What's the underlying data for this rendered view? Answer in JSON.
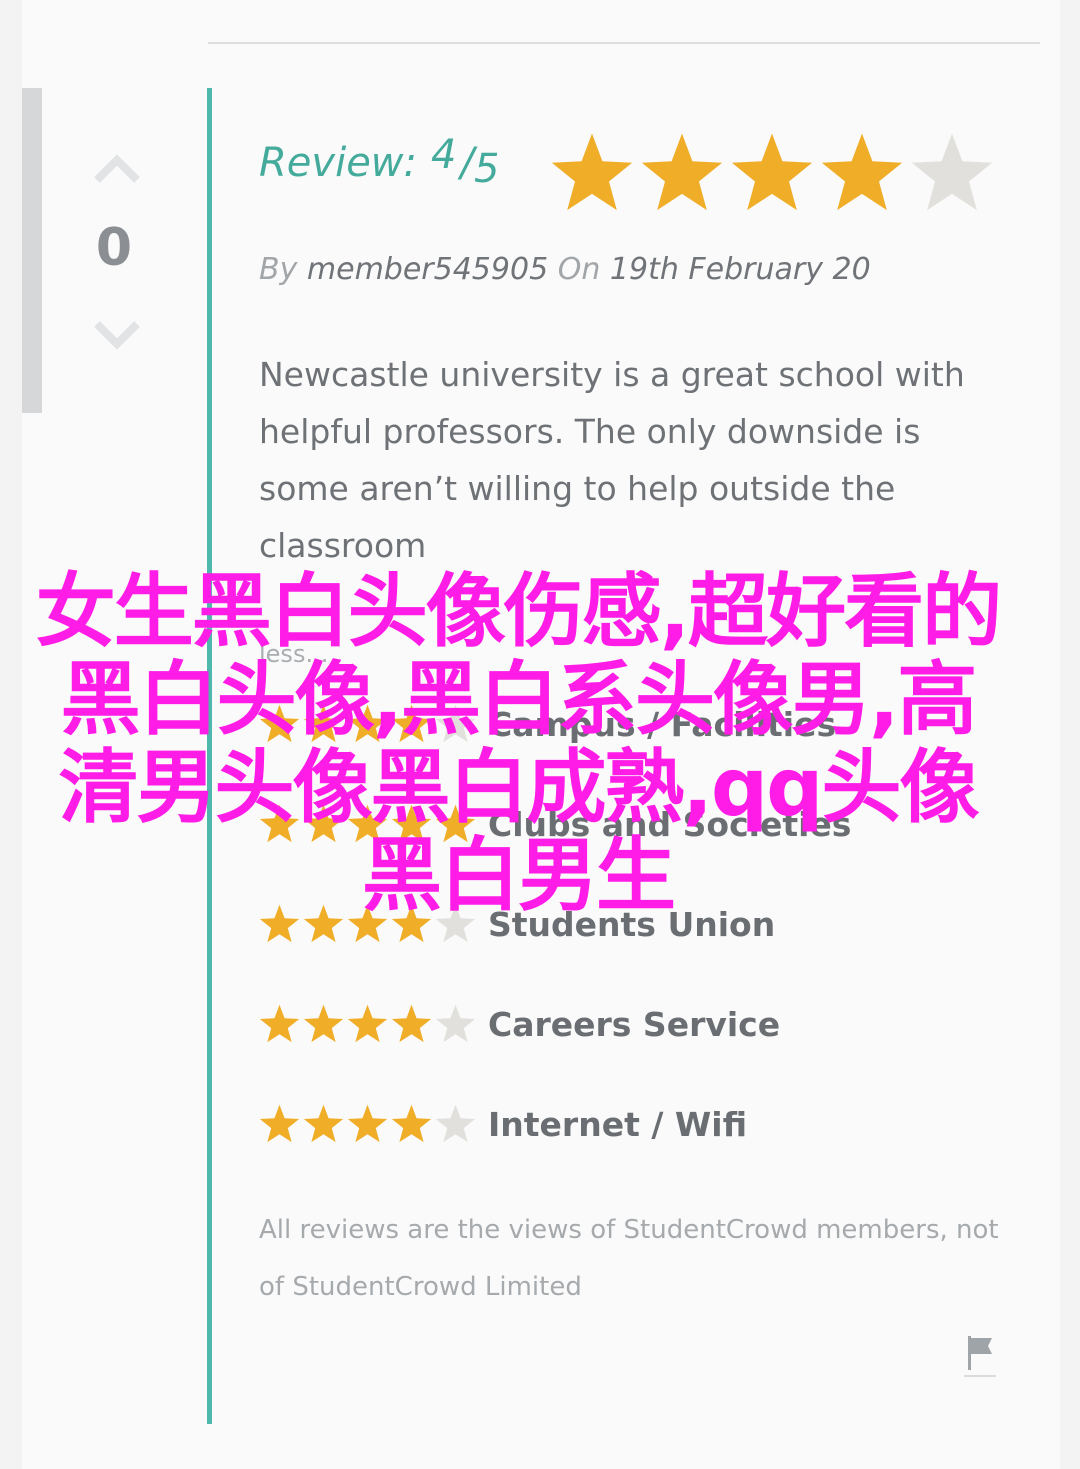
{
  "vote": {
    "count": "0"
  },
  "review": {
    "label": "Review:",
    "score": "4",
    "separator": "/",
    "max": "5",
    "stars_filled": 4,
    "stars_total": 5
  },
  "byline": {
    "by": "By",
    "member": "member545905",
    "on": "On",
    "date": "19th February 20"
  },
  "body": "Newcastle university is a great school with helpful professors. The only downside is some aren’t willing to help outside the classroom",
  "less_link": "less...",
  "ratings": [
    {
      "label": "Campus / Facilities",
      "stars": 4
    },
    {
      "label": "Clubs and Societies",
      "stars": 5
    },
    {
      "label": "Students Union",
      "stars": 4
    },
    {
      "label": "Careers Service",
      "stars": 4
    },
    {
      "label": "Internet / Wifi",
      "stars": 4
    }
  ],
  "disclaimer": "All reviews are the views of StudentCrowd members, not of StudentCrowd Limited",
  "overlay_text": "女生黑白头像伤感,超好看的黑白头像,黑白系头像男,高清男头像黑白成熟,qq头像黑白男生",
  "colors": {
    "star_filled": "#f0ad28",
    "star_empty": "#e1e0dc",
    "accent": "#4fb8ad",
    "overlay": "#ff1ce6"
  }
}
